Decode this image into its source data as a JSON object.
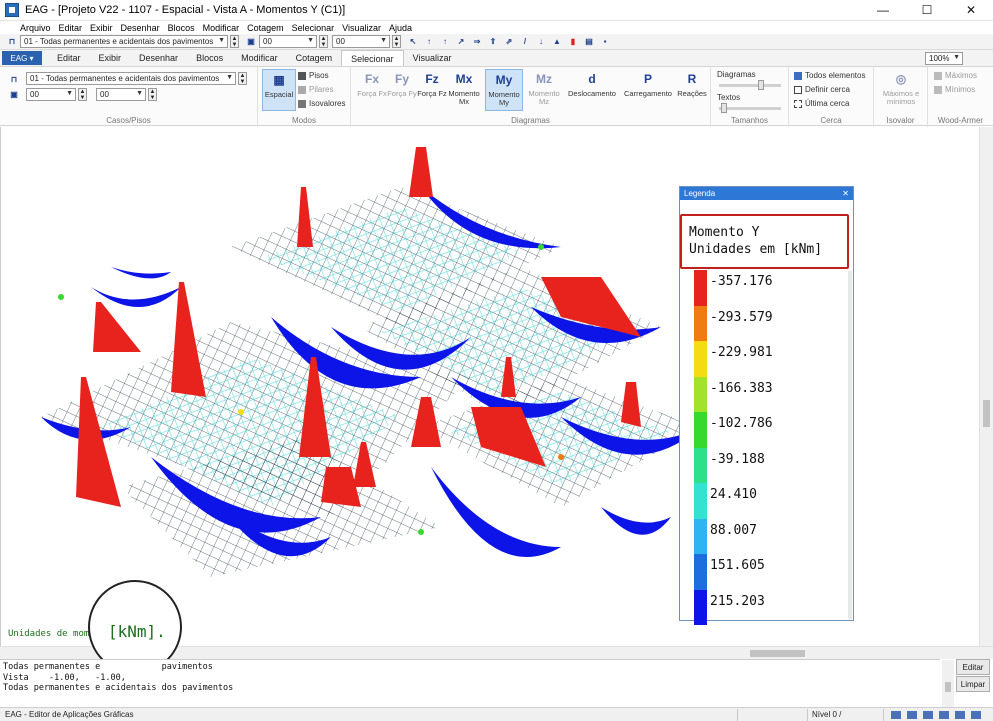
{
  "window": {
    "title": "EAG - [Projeto V22 - 1107 - Espacial - Vista A - Momentos Y (C1)]",
    "controls": [
      "—",
      "☐",
      "✕"
    ]
  },
  "menu": [
    "Arquivo",
    "Editar",
    "Exibir",
    "Desenhar",
    "Blocos",
    "Modificar",
    "Cotagem",
    "Selecionar",
    "Visualizar",
    "Ajuda"
  ],
  "quick_toolbar": {
    "case_combo": "01 - Todas permanentes e acidentais dos pavimentos",
    "floor_a": "00",
    "floor_b": "00"
  },
  "ribbon_tabs": {
    "file": "EAG ▾",
    "tabs": [
      "Editar",
      "Exibir",
      "Desenhar",
      "Blocos",
      "Modificar",
      "Cotagem",
      "Selecionar",
      "Visualizar"
    ],
    "active": "Selecionar",
    "zoom": "100%"
  },
  "ribbon": {
    "casos": {
      "title": "Casos/Pisos",
      "case_combo": "01 - Todas permanentes e acidentais dos pavimentos",
      "floor_a": "00",
      "floor_b": "00"
    },
    "modos": {
      "title": "Modos",
      "espacial": "Espacial",
      "pisos": "Pisos",
      "pilares": "Pilares",
      "isovalores": "Isovalores"
    },
    "diagramas": {
      "title": "Diagramas",
      "buttons": [
        {
          "icon": "Fx",
          "label": "Força Fx",
          "state": "dim"
        },
        {
          "icon": "Fy",
          "label": "Força Fy",
          "state": "dim"
        },
        {
          "icon": "Fz",
          "label": "Força Fz",
          "state": "normal"
        },
        {
          "icon": "Mx",
          "label": "Momento Mx",
          "state": "normal"
        },
        {
          "icon": "My",
          "label": "Momento My",
          "state": "selected"
        },
        {
          "icon": "Mz",
          "label": "Momento Mz",
          "state": "dim"
        },
        {
          "icon": "d",
          "label": "Deslocamento",
          "state": "normal"
        },
        {
          "icon": "P",
          "label": "Carregamento",
          "state": "normal"
        },
        {
          "icon": "R",
          "label": "Reações",
          "state": "normal"
        }
      ]
    },
    "tamanhos": {
      "title": "Tamanhos",
      "diagramas": "Diagramas",
      "textos": "Textos"
    },
    "cerca": {
      "title": "Cerca",
      "todos": "Todos elementos",
      "definir": "Definir cerca",
      "ultima": "Última cerca"
    },
    "isovalor": {
      "title": "Isovalor",
      "maxmin": "Máximos e mínimos"
    },
    "wood": {
      "title": "Wood-Armer",
      "maximos": "Máximos",
      "minimos": "Mínimos"
    }
  },
  "legend": {
    "header": "Legenda",
    "close": "✕",
    "title_line1": "Momento Y",
    "title_line2": "Unidades em [kNm]",
    "entries": [
      {
        "value": "-357.176",
        "color": "#e8231e"
      },
      {
        "value": "-293.579",
        "color": "#f07b10"
      },
      {
        "value": "-229.981",
        "color": "#f5dc12"
      },
      {
        "value": "-166.383",
        "color": "#a2e22a"
      },
      {
        "value": "-102.786",
        "color": "#36d92d"
      },
      {
        "value": "-39.188",
        "color": "#2ee08a"
      },
      {
        "value": "24.410",
        "color": "#33e2d0"
      },
      {
        "value": "88.007",
        "color": "#2fb4f2"
      },
      {
        "value": "151.605",
        "color": "#1f6ee0"
      },
      {
        "value": "215.203",
        "color": "#0c14e8"
      }
    ]
  },
  "command": {
    "line": "Unidades de mom",
    "magnified": "[kNm]."
  },
  "output": {
    "lines": [
      "Todas permanentes e            pavimentos",
      "Vista    -1.00,   -1.00,",
      "Todas permanentes e acidentais dos pavimentos"
    ],
    "btn_editar": "Editar",
    "btn_limpar": "Limpar"
  },
  "status": {
    "text": "EAG - Editor de Aplicações Gráficas",
    "nivel": "Nível 0 /"
  }
}
